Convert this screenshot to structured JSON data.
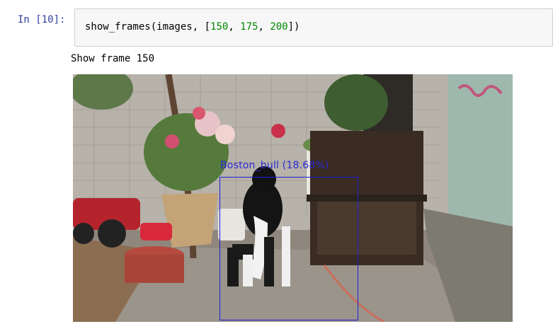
{
  "cell": {
    "prompt": "In [10]:",
    "code_prefix": "show_frames(images, [",
    "args": [
      "150",
      "175",
      "200"
    ],
    "code_suffix": "])"
  },
  "output": {
    "text": "Show frame 150"
  },
  "frame_image": {
    "detection": {
      "label": "Boston_bull (18.68%)",
      "box_color": "#1f1fd8"
    }
  }
}
